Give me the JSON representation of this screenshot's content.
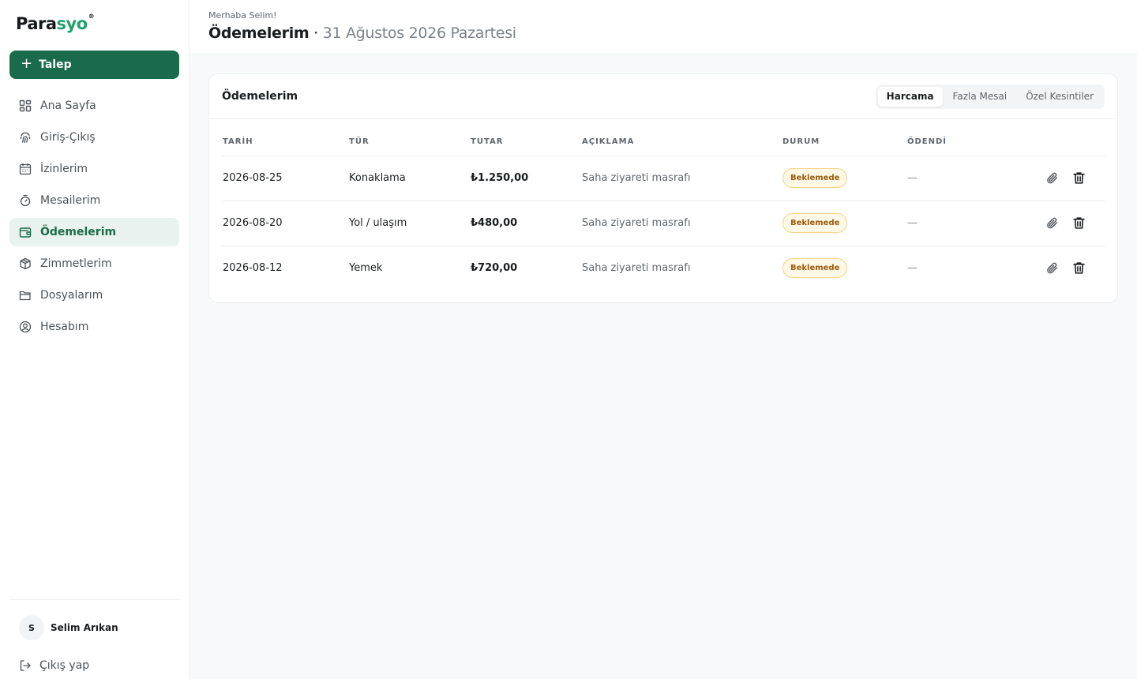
{
  "brand": {
    "part1": "Para",
    "part2": "syo",
    "mark": "®"
  },
  "sidebar": {
    "new_request_label": "Talep",
    "items": [
      {
        "label": "Ana Sayfa",
        "icon": "grid-icon"
      },
      {
        "label": "Giriş-Çıkış",
        "icon": "fingerprint-icon"
      },
      {
        "label": "İzinlerim",
        "icon": "calendar-icon"
      },
      {
        "label": "Mesailerim",
        "icon": "timer-icon"
      },
      {
        "label": "Ödemelerim",
        "icon": "wallet-icon",
        "active": true
      },
      {
        "label": "Zimmetlerim",
        "icon": "box-icon"
      },
      {
        "label": "Dosyalarım",
        "icon": "folder-icon"
      },
      {
        "label": "Hesabım",
        "icon": "user-circle-icon"
      }
    ],
    "user": {
      "initial": "S",
      "name": "Selim Arıkan"
    },
    "logout_label": "Çıkış yap"
  },
  "header": {
    "greeting": "Merhaba Selim!",
    "title": "Ödemelerim",
    "separator": "·",
    "date": "31 Ağustos 2026 Pazartesi"
  },
  "card": {
    "title": "Ödemelerim",
    "tabs": [
      {
        "label": "Harcama",
        "active": true
      },
      {
        "label": "Fazla Mesai"
      },
      {
        "label": "Özel Kesintiler"
      }
    ],
    "columns": [
      "TARİH",
      "TÜR",
      "TUTAR",
      "AÇIKLAMA",
      "DURUM",
      "ÖDENDİ"
    ],
    "rows": [
      {
        "date": "2026-08-25",
        "type": "Konaklama",
        "amount": "₺1.250,00",
        "desc": "Saha ziyareti masrafı",
        "status": "Beklemede",
        "paid": "—"
      },
      {
        "date": "2026-08-20",
        "type": "Yol / ulaşım",
        "amount": "₺480,00",
        "desc": "Saha ziyareti masrafı",
        "status": "Beklemede",
        "paid": "—"
      },
      {
        "date": "2026-08-12",
        "type": "Yemek",
        "amount": "₺720,00",
        "desc": "Saha ziyareti masrafı",
        "status": "Beklemede",
        "paid": "—"
      }
    ]
  },
  "colors": {
    "brand_green": "#1a6b4c",
    "accent_green": "#22a06b",
    "pending_badge": "#fff8e6"
  }
}
